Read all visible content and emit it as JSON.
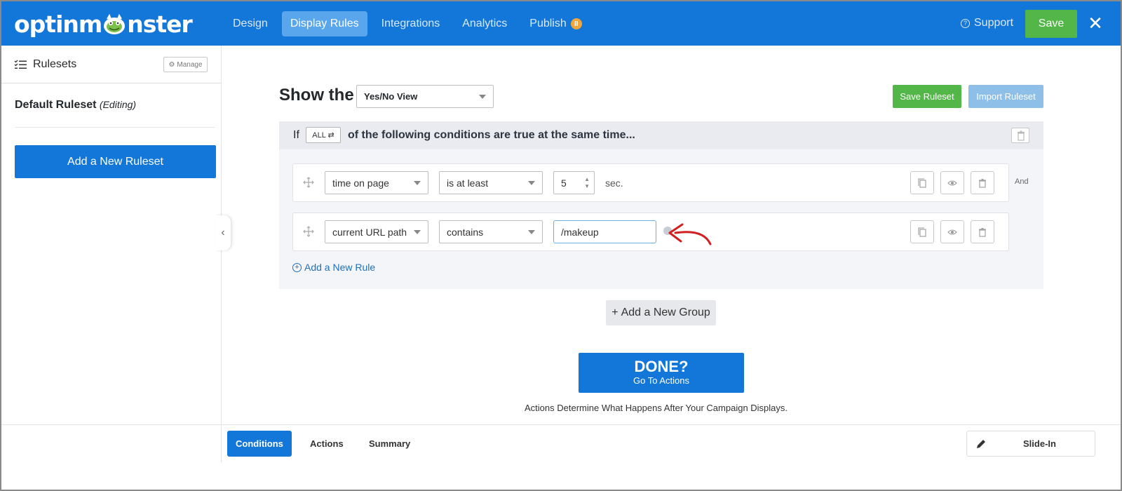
{
  "header": {
    "logo": {
      "pre": "optinm",
      "post": "nster"
    },
    "nav": [
      {
        "label": "Design",
        "active": false
      },
      {
        "label": "Display Rules",
        "active": true
      },
      {
        "label": "Integrations",
        "active": false
      },
      {
        "label": "Analytics",
        "active": false
      },
      {
        "label": "Publish",
        "active": false
      }
    ],
    "publish_badge": "II",
    "support_label": "Support",
    "save_label": "Save",
    "close_glyph": "✕",
    "colors": {
      "bar": "#1377d9",
      "save": "#52b748"
    }
  },
  "sidebar": {
    "title": "Rulesets",
    "manage_label": "Manage",
    "ruleset_name": "Default Ruleset",
    "ruleset_status": "(Editing)",
    "add_ruleset_label": "Add a New Ruleset",
    "collapse_glyph": "‹"
  },
  "main": {
    "show_the": "Show the",
    "view_select": "Yes/No View",
    "save_ruleset": "Save Ruleset",
    "import_ruleset": "Import Ruleset",
    "group": {
      "if_label": "If",
      "all_label": "ALL ⇄",
      "condition_text": "of the following conditions are true at the same time...",
      "rules": [
        {
          "field": "time on page",
          "operator": "is at least",
          "value": "5",
          "unit": "sec."
        },
        {
          "field": "current URL path",
          "operator": "contains",
          "value": "/makeup"
        }
      ],
      "and_label": "And",
      "add_rule_label": "Add a New Rule"
    },
    "add_group_label": "Add a New Group",
    "done_title": "DONE?",
    "done_sub": "Go To Actions",
    "actions_note": "Actions Determine What Happens After Your Campaign Displays."
  },
  "bottom": {
    "tabs": [
      {
        "label": "Conditions",
        "active": true
      },
      {
        "label": "Actions",
        "active": false
      },
      {
        "label": "Summary",
        "active": false
      }
    ],
    "campaign_type": "Slide-In"
  }
}
